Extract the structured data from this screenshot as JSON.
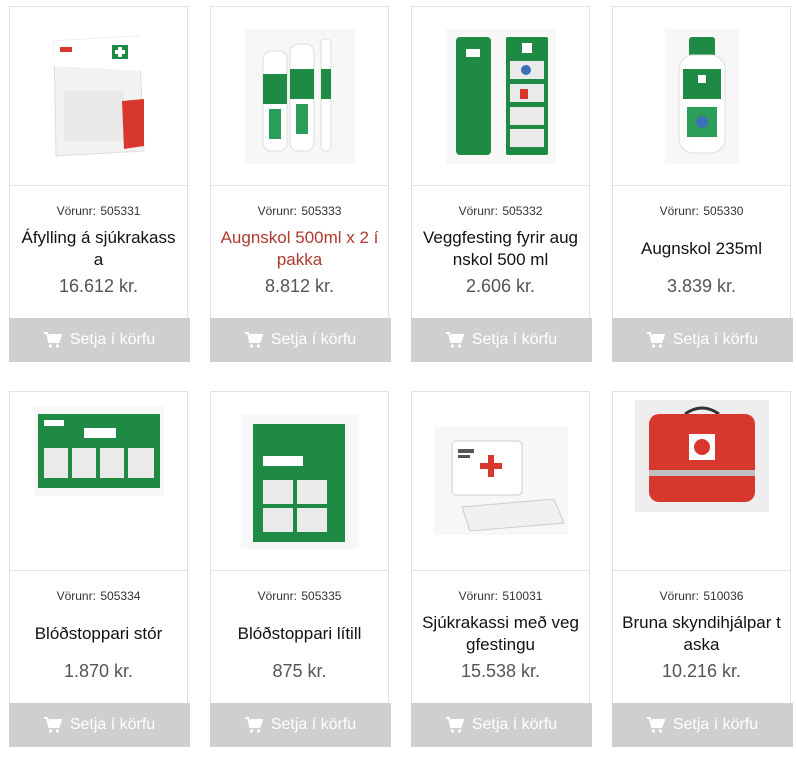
{
  "sku_prefix": "Vörunr:",
  "cart_label": "Setja í körfu",
  "products": [
    {
      "sku": "505331",
      "title": "Áfylling á sjúkrakassa",
      "price": "16.612 kr."
    },
    {
      "sku": "505333",
      "title": "Augnskol 500ml x 2 í pakka",
      "price": "8.812 kr."
    },
    {
      "sku": "505332",
      "title": "Veggfesting fyrir augnskol 500 ml",
      "price": "2.606 kr."
    },
    {
      "sku": "505330",
      "title": "Augnskol 235ml",
      "price": "3.839 kr."
    },
    {
      "sku": "505334",
      "title": "Blóðstoppari stór",
      "price": "1.870 kr."
    },
    {
      "sku": "505335",
      "title": "Blóðstoppari lítill",
      "price": "875 kr."
    },
    {
      "sku": "510031",
      "title": "Sjúkrakassi með veggfestingu",
      "price": "15.538 kr."
    },
    {
      "sku": "510036",
      "title": "Bruna skyndihjálpar taska",
      "price": "10.216 kr."
    }
  ],
  "colors": {
    "title_highlight": "#b03a2e",
    "button_bg": "#cfcfcf",
    "product_green": "#1f8a43",
    "product_red": "#d8372d"
  },
  "product_images": [
    "refill-box-image",
    "eyewash-2pack-image",
    "wall-mount-image",
    "eyewash-235ml-image",
    "bloodstopper-large-image",
    "bloodstopper-small-image",
    "firstaid-box-wallmount-image",
    "burn-firstaid-bag-image"
  ]
}
